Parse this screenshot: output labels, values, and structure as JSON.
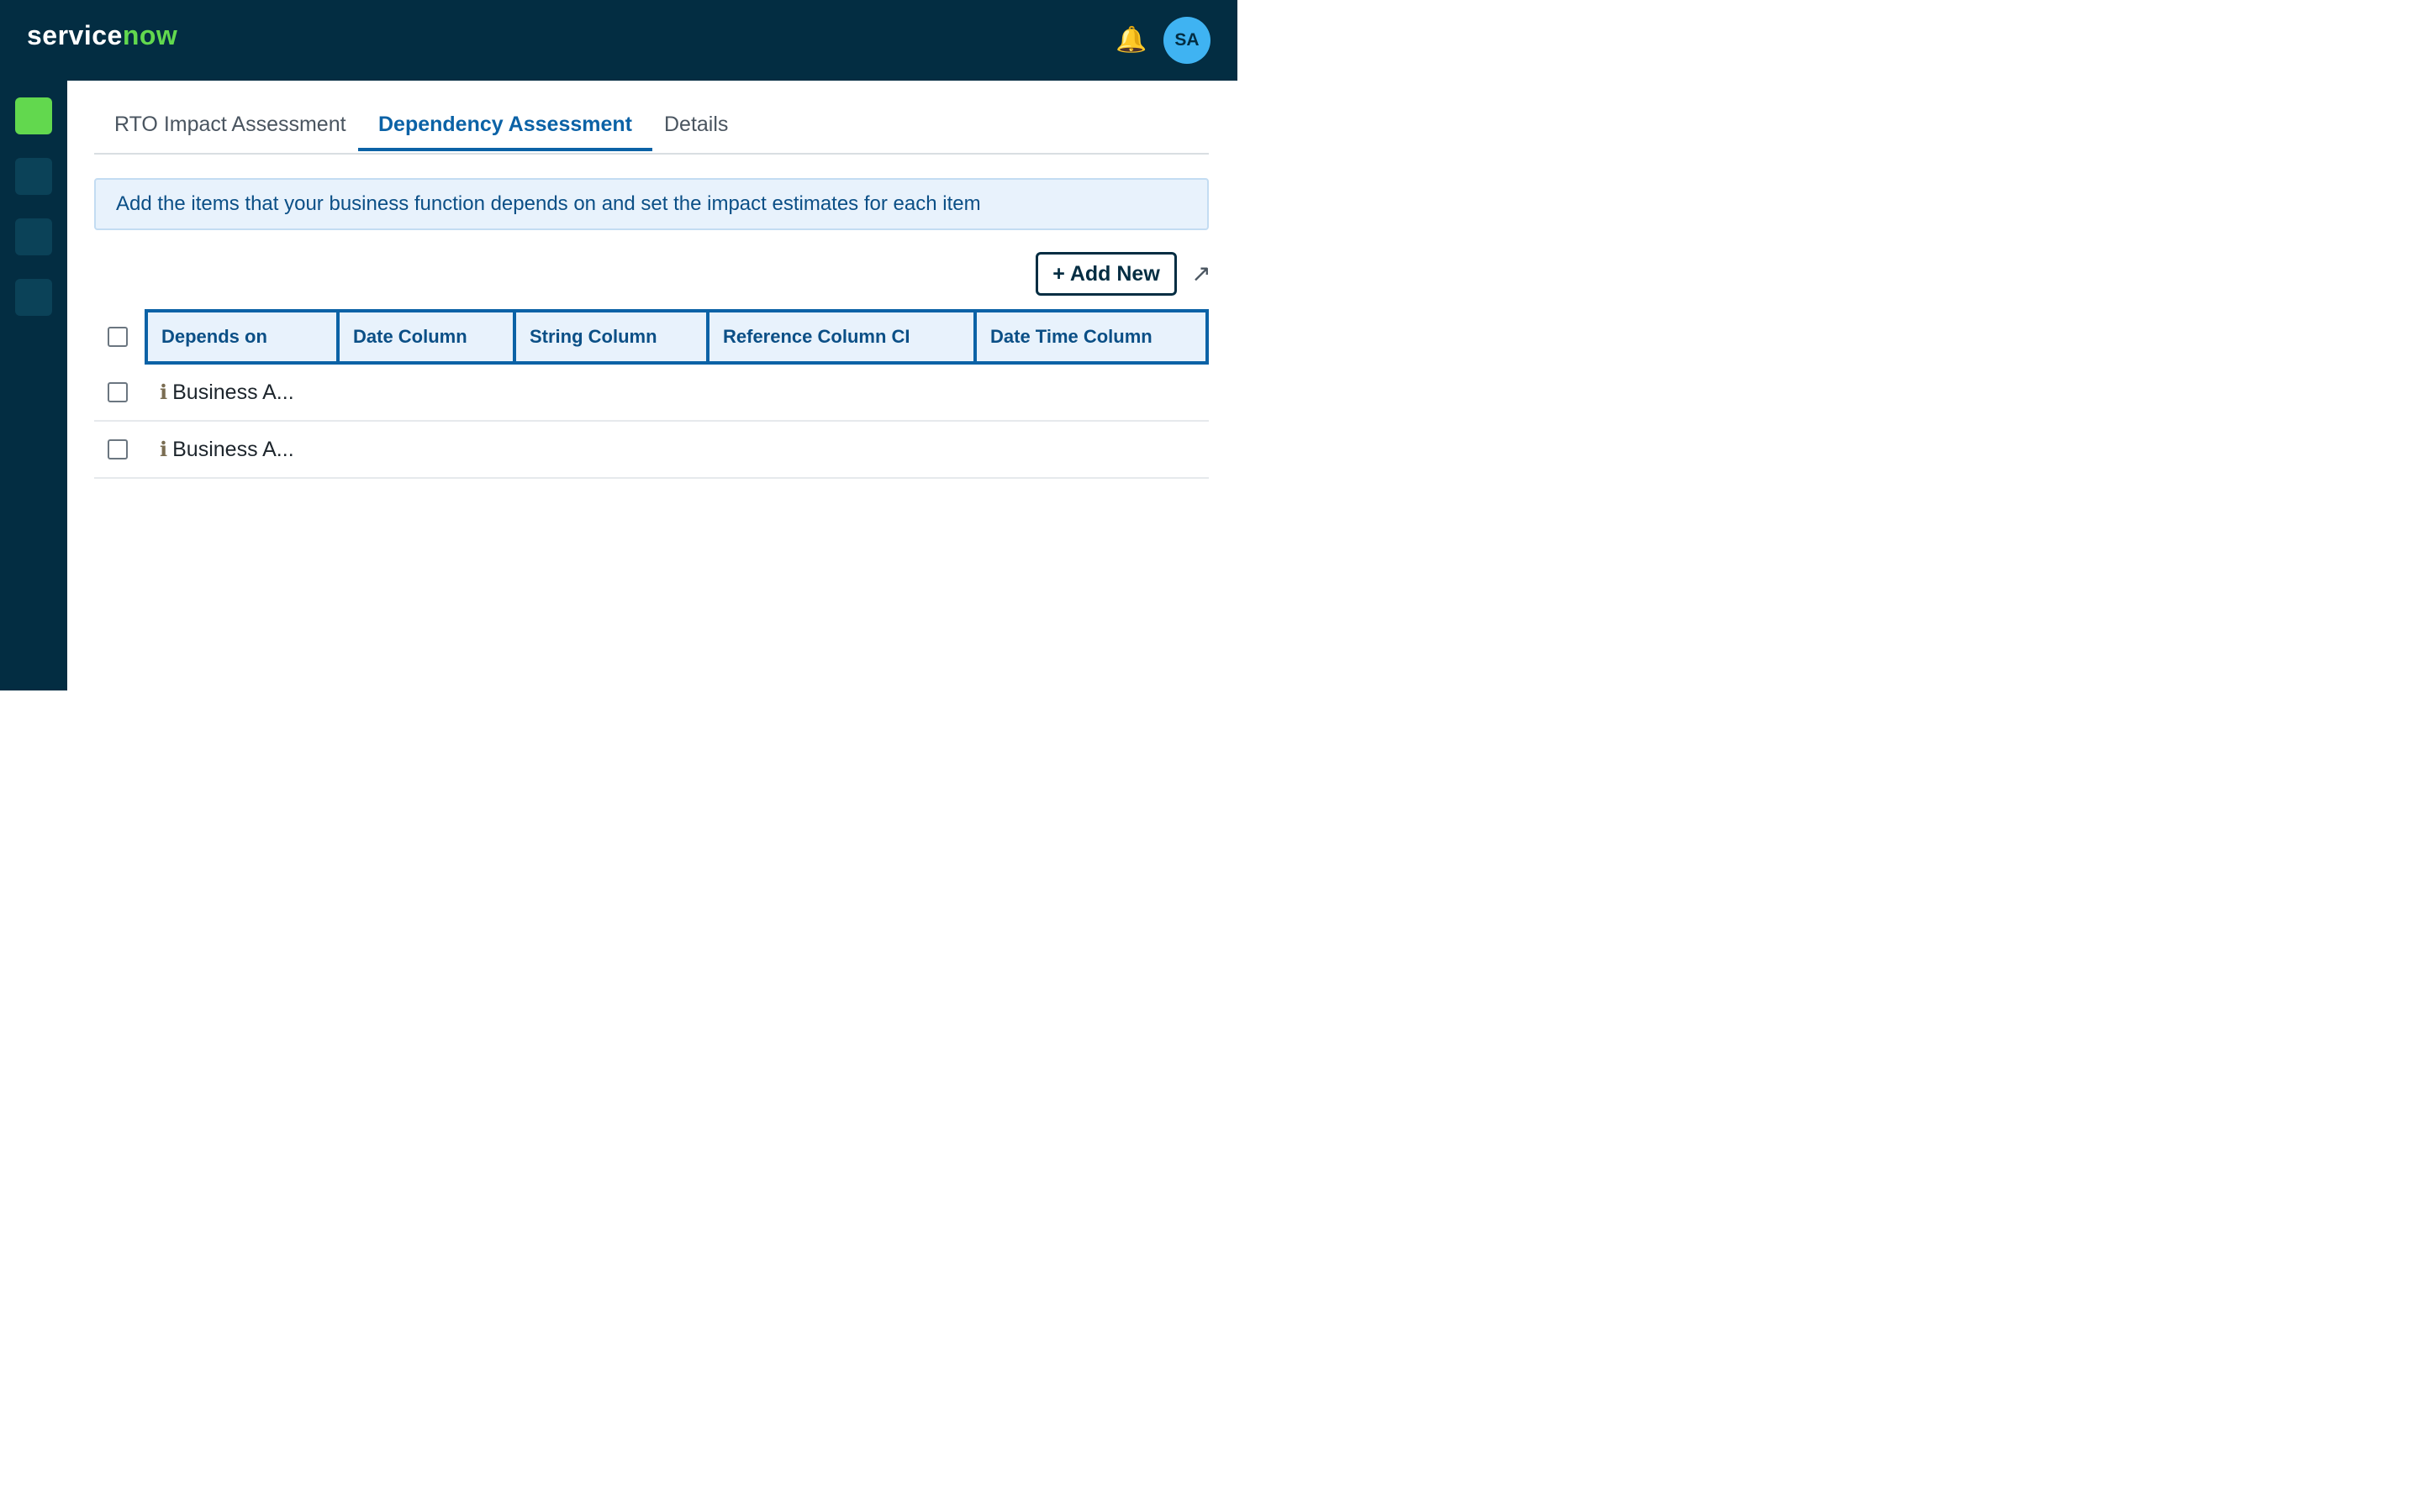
{
  "header": {
    "brand_part1": "service",
    "brand_part2": "now",
    "notifications_icon": "bell-icon",
    "avatar_initials": "SA"
  },
  "sidebar": {
    "items": [
      {
        "state": "active",
        "color": "#62d84e"
      },
      {
        "state": "inactive"
      },
      {
        "state": "inactive"
      },
      {
        "state": "inactive"
      }
    ]
  },
  "tabs": [
    {
      "label": "RTO Impact Assessment",
      "active": false
    },
    {
      "label": "Dependency Assessment",
      "active": true
    },
    {
      "label": "Details",
      "active": false
    }
  ],
  "banner": {
    "text": "Add the items that your business function depends on and set the impact estimates for each item"
  },
  "toolbar": {
    "add_new_label": "+ Add New",
    "expand_icon": "↗"
  },
  "table": {
    "columns": [
      "Depends on",
      "Date Column",
      "String Column",
      "Reference Column CI",
      "Date Time Column"
    ],
    "rows": [
      {
        "depends_on": "Business A...",
        "info_icon": "ℹ"
      },
      {
        "depends_on": "Business A...",
        "info_icon": "ℹ"
      }
    ]
  },
  "colors": {
    "topbar": "#032d42",
    "accent_green": "#62d84e",
    "link_blue": "#0b62a6",
    "avatar_bg": "#3fb3f2"
  }
}
